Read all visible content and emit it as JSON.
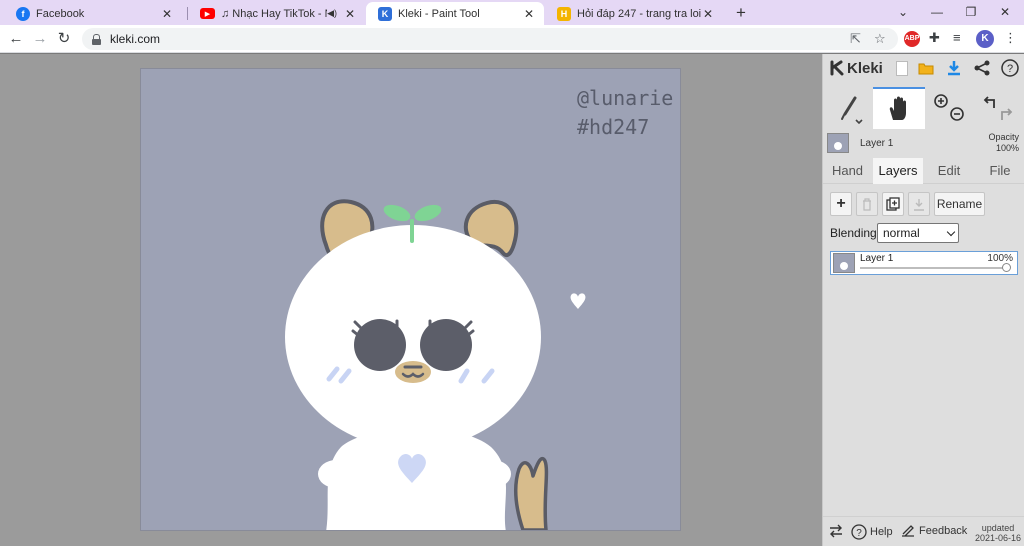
{
  "browser": {
    "tabs": [
      {
        "title": "Facebook",
        "favicon": "facebook-icon",
        "color": "#1877f2",
        "active": false
      },
      {
        "title": "♫ Nhạc Hay TikTok - Nàng K",
        "favicon": "youtube-icon",
        "color": "#ff0000",
        "active": false,
        "audio": true
      },
      {
        "title": "Kleki - Paint Tool",
        "favicon": "kleki-icon",
        "color": "#2f6fd8",
        "active": true
      },
      {
        "title": "Hỏi đáp 247 - trang tra loi",
        "favicon": "hoidap-icon",
        "color": "#f4b400",
        "active": false
      }
    ],
    "new_tab": "+",
    "url": "kleki.com",
    "profile_initial": "K",
    "extensions": [
      "abp-icon",
      "puzzle-icon",
      "media-icon"
    ]
  },
  "canvas": {
    "background": "#9da2b5",
    "signature_line1": "@lunarie",
    "signature_line2": "#hd247"
  },
  "kleki": {
    "brand": "Kleki",
    "layer_header": {
      "name": "Layer 1",
      "opacity_label": "Opacity",
      "opacity_value": "100%"
    },
    "tabs": [
      "Hand",
      "Layers",
      "Edit",
      "File"
    ],
    "active_tab": "Layers",
    "rename_label": "Rename",
    "blending_label": "Blending",
    "blending_value": "normal",
    "layers": [
      {
        "name": "Layer 1",
        "opacity": "100%",
        "opacity_value": 1.0
      }
    ],
    "footer": {
      "help": "Help",
      "feedback": "Feedback",
      "updated_label": "updated",
      "updated_date": "2021-06-16"
    },
    "accent": "#4a90e2"
  }
}
